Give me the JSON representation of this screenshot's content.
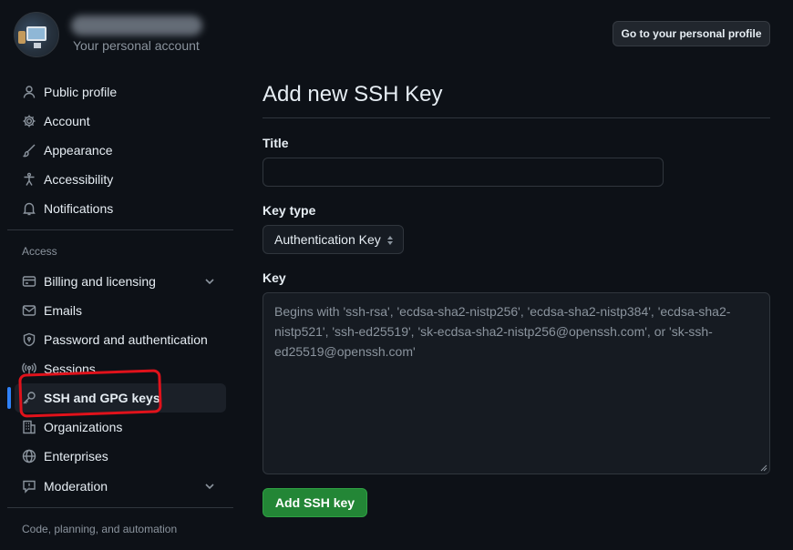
{
  "header": {
    "subtitle": "Your personal account",
    "profile_button": "Go to your personal profile"
  },
  "sidebar": {
    "items": [
      {
        "label": "Public profile",
        "icon": "person-icon"
      },
      {
        "label": "Account",
        "icon": "gear-icon"
      },
      {
        "label": "Appearance",
        "icon": "paintbrush-icon"
      },
      {
        "label": "Accessibility",
        "icon": "accessibility-icon"
      },
      {
        "label": "Notifications",
        "icon": "bell-icon"
      }
    ],
    "access_heading": "Access",
    "access_items": [
      {
        "label": "Billing and licensing",
        "icon": "credit-card-icon",
        "expandable": true
      },
      {
        "label": "Emails",
        "icon": "mail-icon"
      },
      {
        "label": "Password and authentication",
        "icon": "shield-lock-icon"
      },
      {
        "label": "Sessions",
        "icon": "broadcast-icon"
      },
      {
        "label": "SSH and GPG keys",
        "icon": "key-icon",
        "active": true
      },
      {
        "label": "Organizations",
        "icon": "organization-icon"
      },
      {
        "label": "Enterprises",
        "icon": "globe-icon"
      },
      {
        "label": "Moderation",
        "icon": "report-icon",
        "expandable": true
      }
    ],
    "code_heading": "Code, planning, and automation"
  },
  "main": {
    "title": "Add new SSH Key",
    "title_label": "Title",
    "title_value": "",
    "key_type_label": "Key type",
    "key_type_selected": "Authentication Key",
    "key_label": "Key",
    "key_placeholder": "Begins with 'ssh-rsa', 'ecdsa-sha2-nistp256', 'ecdsa-sha2-nistp384', 'ecdsa-sha2-nistp521', 'ssh-ed25519', 'sk-ecdsa-sha2-nistp256@openssh.com', or 'sk-ssh-ed25519@openssh.com'",
    "submit_label": "Add SSH key"
  },
  "colors": {
    "background": "#0d1117",
    "accent_blue": "#2f81f7",
    "button_green": "#238636",
    "annotation_red": "#e0121b"
  }
}
